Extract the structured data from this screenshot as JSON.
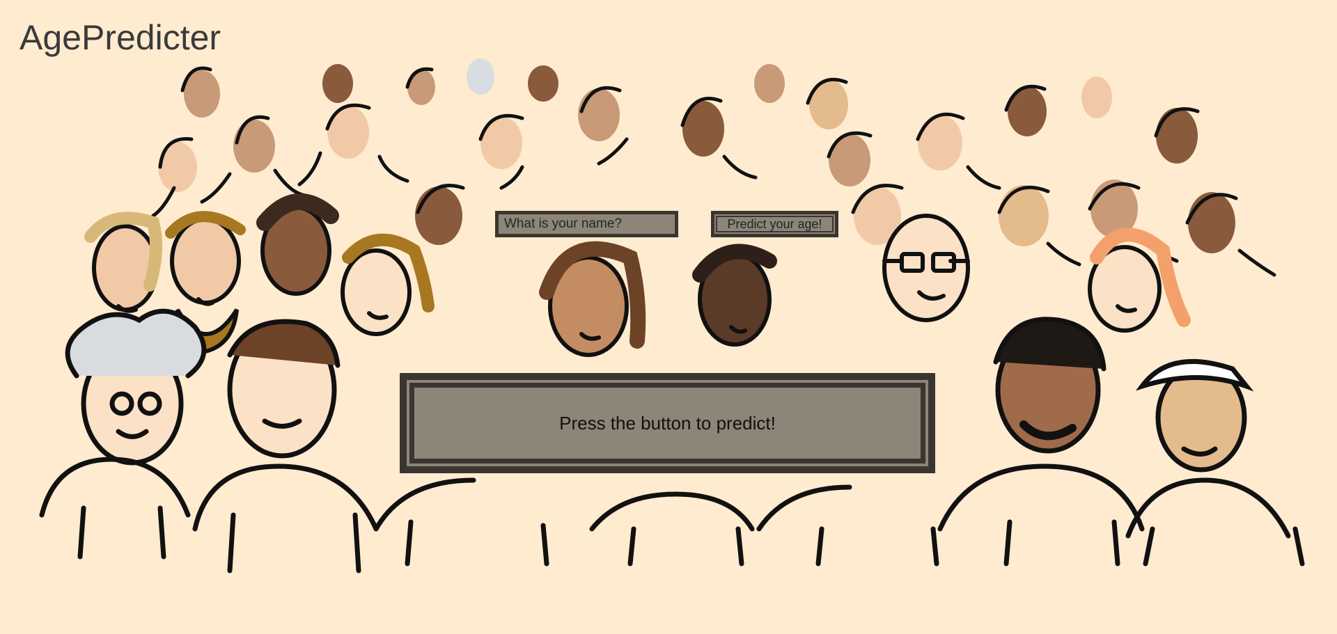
{
  "app": {
    "title": "AgePredicter"
  },
  "form": {
    "name_placeholder": "What is your name?",
    "name_value": "",
    "predict_button_label": "Predict your age!"
  },
  "result": {
    "message": "Press the button to predict!"
  },
  "colors": {
    "background": "#feebd0",
    "control_fill": "#8d8577",
    "control_border": "#3a3530",
    "title_text": "#3a3a3a"
  },
  "background_image": {
    "subject": "crowd-illustration"
  }
}
